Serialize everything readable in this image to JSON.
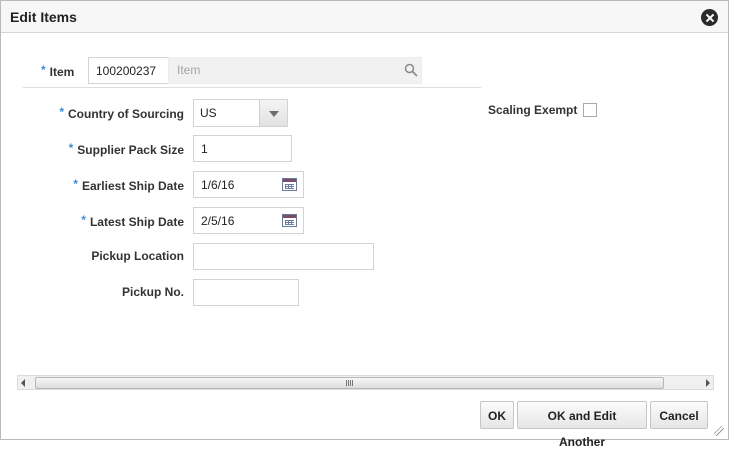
{
  "dialog": {
    "title": "Edit Items",
    "close_icon": "close-circle-icon"
  },
  "form": {
    "required_marker": "*",
    "item": {
      "label": "Item",
      "value": "100200237",
      "description_placeholder": "Item",
      "search_icon": "search-icon"
    },
    "country_of_sourcing": {
      "label": "Country of Sourcing",
      "value": "US"
    },
    "supplier_pack_size": {
      "label": "Supplier Pack Size",
      "value": "1"
    },
    "earliest_ship_date": {
      "label": "Earliest Ship Date",
      "value": "1/6/16",
      "icon": "calendar-icon"
    },
    "latest_ship_date": {
      "label": "Latest Ship Date",
      "value": "2/5/16",
      "icon": "calendar-icon"
    },
    "pickup_location": {
      "label": "Pickup Location",
      "value": ""
    },
    "pickup_no": {
      "label": "Pickup No.",
      "value": ""
    },
    "scaling_exempt": {
      "label": "Scaling Exempt",
      "checked": false
    }
  },
  "footer": {
    "ok_label": "OK",
    "ok_edit_another_label": "OK and Edit Another",
    "cancel_label": "Cancel"
  },
  "colors": {
    "required_marker": "#3b8ed6",
    "title_bar": "#f7f7f7"
  }
}
